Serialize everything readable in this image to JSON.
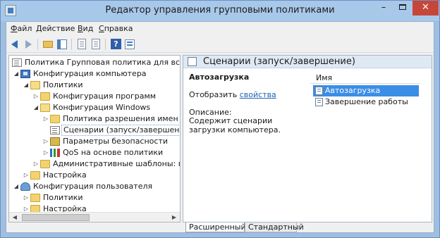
{
  "window": {
    "title": "Редактор управления групповыми политиками",
    "controls": {
      "minimize": "–",
      "close": "✕"
    }
  },
  "menu": [
    {
      "label_pre": "",
      "label_u": "Ф",
      "label_post": "айл"
    },
    {
      "label_pre": "",
      "label_u": "Д",
      "label_post": "ействие"
    },
    {
      "label_pre": "",
      "label_u": "В",
      "label_post": "ид"
    },
    {
      "label_pre": "",
      "label_u": "С",
      "label_post": "правка"
    }
  ],
  "toolbar": {
    "icons": [
      "back-icon",
      "forward-icon",
      "up-folder-icon",
      "show-hide-tree-icon",
      "export-list-icon",
      "export-icon",
      "help-icon",
      "properties-icon"
    ]
  },
  "tree": {
    "items": [
      {
        "label": "Политика Групповая политика для всех компьютеров",
        "icon": "policy",
        "level": 0,
        "expander": ""
      },
      {
        "label": "Конфигурация компьютера",
        "icon": "computer",
        "level": 1,
        "expander": "◢"
      },
      {
        "label": "Политики",
        "icon": "folder-open",
        "level": 2,
        "expander": "◢"
      },
      {
        "label": "Конфигурация программ",
        "icon": "folder",
        "level": 3,
        "expander": "▷"
      },
      {
        "label": "Конфигурация Windows",
        "icon": "folder-open",
        "level": 3,
        "expander": "◢"
      },
      {
        "label": "Политика разрешения имен",
        "icon": "folder",
        "level": 4,
        "expander": "▷"
      },
      {
        "label": "Сценарии (запуск/завершение)",
        "icon": "policy",
        "level": 4,
        "expander": "",
        "selected": true
      },
      {
        "label": "Параметры безопасности",
        "icon": "lock",
        "level": 4,
        "expander": "▷"
      },
      {
        "label": "QoS на основе политики",
        "icon": "chart",
        "level": 4,
        "expander": "▷"
      },
      {
        "label": "Административные шаблоны: получены",
        "icon": "folder",
        "level": 3,
        "expander": "▷"
      },
      {
        "label": "Настройка",
        "icon": "folder",
        "level": 2,
        "expander": "▷"
      },
      {
        "label": "Конфигурация пользователя",
        "icon": "user",
        "level": 1,
        "expander": "◢"
      },
      {
        "label": "Политики",
        "icon": "folder",
        "level": 2,
        "expander": "▷"
      },
      {
        "label": "Настройка",
        "icon": "folder",
        "level": 2,
        "expander": "▷"
      }
    ],
    "scroll_left": "◀",
    "scroll_right": "▶"
  },
  "details": {
    "header_title": "Сценарии (запуск/завершение)",
    "title": "Автозагрузка",
    "show_prefix": "Отобразить ",
    "show_link": "свойства",
    "description_label": "Описание:",
    "description_text": "Содержит сценарии загрузки компьютера.",
    "column_name": "Имя",
    "rows": [
      {
        "label": "Автозагрузка",
        "selected": true
      },
      {
        "label": "Завершение работы",
        "selected": false
      }
    ]
  },
  "tabs": [
    {
      "label": "Расширенный",
      "active": true
    },
    {
      "label": "Стандартный",
      "active": false
    }
  ]
}
